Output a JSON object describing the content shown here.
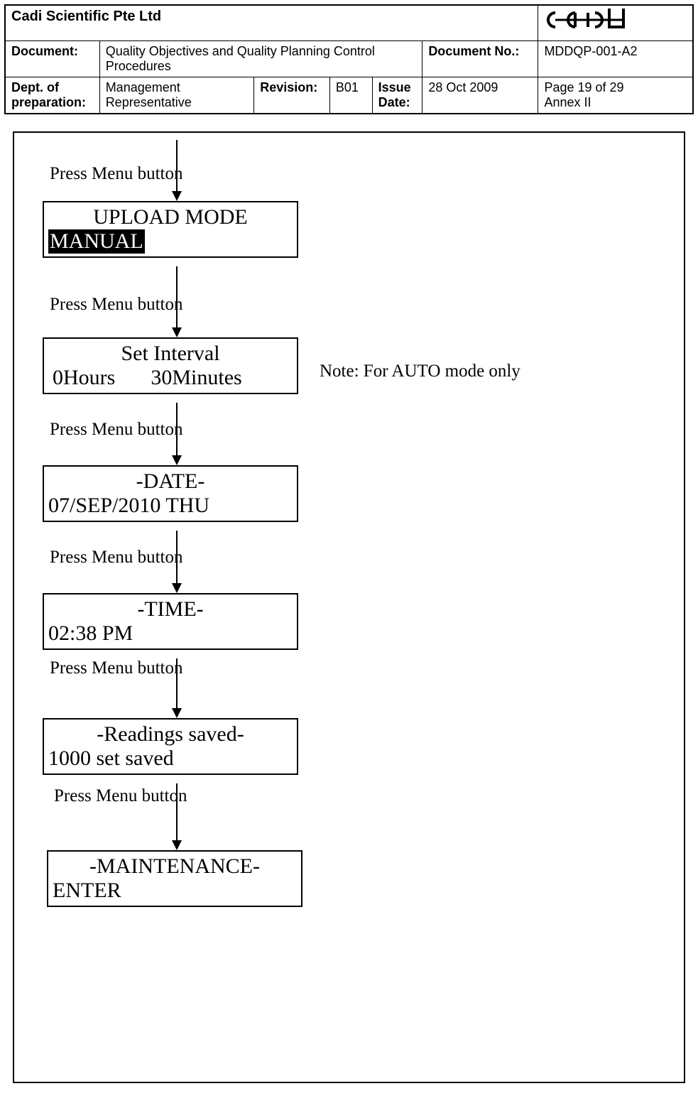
{
  "header": {
    "company": "Cadi Scientific Pte Ltd",
    "document_label": "Document:",
    "document_title": "Quality Objectives and Quality Planning Control Procedures",
    "document_no_label": "Document No.:",
    "document_no": "MDDQP-001-A2",
    "dept_label": "Dept. of preparation:",
    "dept_value": "Management Representative",
    "revision_label": "Revision:",
    "revision_value": "B01",
    "issue_date_label": "Issue Date:",
    "issue_date_value": "28 Oct 2009",
    "page_text_1": "Page 19 of 29",
    "page_text_2": "Annex II"
  },
  "flow": {
    "press_menu": "Press Menu button",
    "note": "Note: For AUTO mode only",
    "box1_line1": "UPLOAD MODE",
    "box1_line2": "MANUAL",
    "box2_line1": "Set Interval",
    "box2_hours": "0Hours",
    "box2_minutes": "30Minutes",
    "box3_line1": "-DATE-",
    "box3_line2": "07/SEP/2010    THU",
    "box4_line1": "-TIME-",
    "box4_line2": "02:38  PM",
    "box5_line1": "-Readings saved-",
    "box5_line2": "1000 set saved",
    "box6_line1": "-MAINTENANCE-",
    "box6_line2": "ENTER"
  }
}
